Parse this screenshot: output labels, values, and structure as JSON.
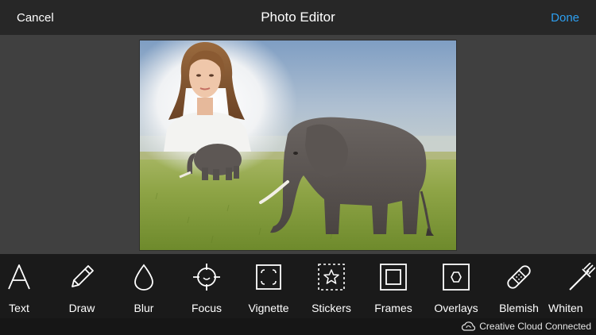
{
  "header": {
    "cancel_label": "Cancel",
    "title": "Photo Editor",
    "done_label": "Done"
  },
  "colors": {
    "accent": "#2d9ff0",
    "toolbar_bg": "#1a1a1a",
    "header_bg": "#272727",
    "canvas_bg": "#404040"
  },
  "tools": [
    {
      "label": "Text",
      "icon": "text-icon"
    },
    {
      "label": "Draw",
      "icon": "pencil-icon"
    },
    {
      "label": "Blur",
      "icon": "drop-icon"
    },
    {
      "label": "Focus",
      "icon": "crosshair-icon"
    },
    {
      "label": "Vignette",
      "icon": "vignette-icon"
    },
    {
      "label": "Stickers",
      "icon": "star-sticker-icon"
    },
    {
      "label": "Frames",
      "icon": "frame-icon"
    },
    {
      "label": "Overlays",
      "icon": "hexagon-overlay-icon"
    },
    {
      "label": "Blemish",
      "icon": "bandage-icon"
    },
    {
      "label": "Whiten",
      "icon": "toothbrush-icon"
    }
  ],
  "status": {
    "creative_cloud_label": "Creative Cloud Connected"
  }
}
